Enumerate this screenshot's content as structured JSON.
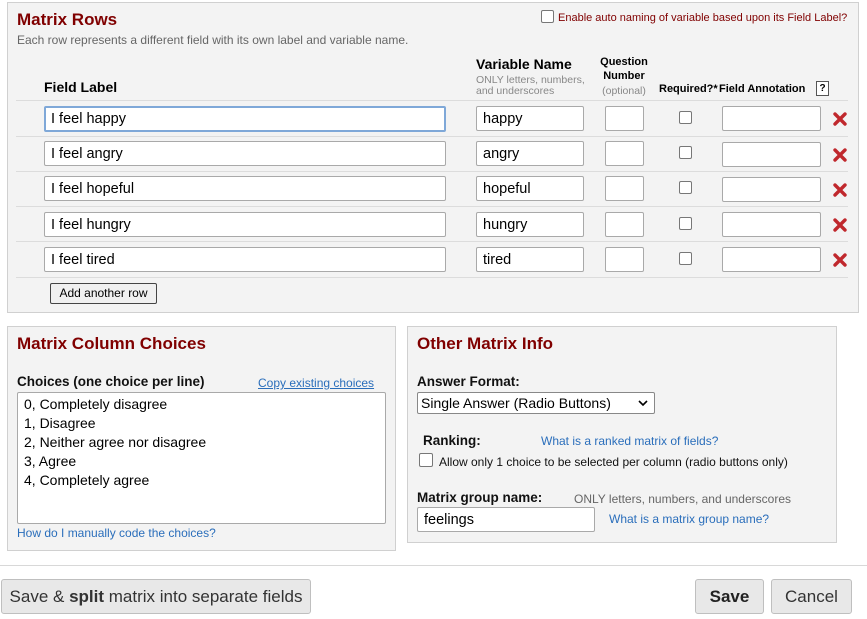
{
  "matrix_rows": {
    "title": "Matrix Rows",
    "auto_naming_label": "Enable auto naming of variable based upon its Field Label?",
    "subtitle": "Each row represents a different field with its own label and variable name.",
    "col_field_label": "Field Label",
    "col_variable_name": "Variable Name",
    "col_variable_hint_1": "ONLY letters, numbers,",
    "col_variable_hint_2": "and underscores",
    "col_question_1": "Question",
    "col_question_2": "Number",
    "col_question_3": "(optional)",
    "col_required": "Required?*",
    "col_annotation": "Field Annotation",
    "help_glyph": "?",
    "rows": [
      {
        "label": "I feel happy",
        "variable": "happy"
      },
      {
        "label": "I feel angry",
        "variable": "angry"
      },
      {
        "label": "I feel hopeful",
        "variable": "hopeful"
      },
      {
        "label": "I feel hungry",
        "variable": "hungry"
      },
      {
        "label": "I feel tired",
        "variable": "tired"
      }
    ],
    "add_row_label": "Add another row"
  },
  "column_choices": {
    "title": "Matrix Column Choices",
    "choices_label": "Choices (one choice per line)",
    "copy_link": "Copy existing choices",
    "choices": [
      "0, Completely disagree",
      "1, Disagree",
      "2, Neither agree nor disagree",
      "3, Agree",
      "4, Completely agree"
    ],
    "manual_code_link": "How do I manually code the choices?"
  },
  "other_info": {
    "title": "Other Matrix Info",
    "answer_format_label": "Answer Format:",
    "answer_format_value": "Single Answer (Radio Buttons)",
    "ranking_label": "Ranking:",
    "ranking_link": "What is a ranked matrix of fields?",
    "ranking_option": "Allow only 1 choice to be selected per column (radio buttons only)",
    "group_name_label": "Matrix group name:",
    "group_name_hint": "ONLY letters, numbers, and underscores",
    "group_name_value": "feelings",
    "group_name_link": "What is a matrix group name?"
  },
  "footer": {
    "split_prefix": "Save & ",
    "split_bold": "split",
    "split_suffix": " matrix into separate fields",
    "save_label": "Save",
    "cancel_label": "Cancel"
  },
  "icons": {
    "delete": "delete-x-icon",
    "dropdown": "chevron-down-icon",
    "help": "help-icon"
  },
  "colors": {
    "heading": "#800000",
    "delete": "#c0282d",
    "link": "#2a6ebb"
  }
}
